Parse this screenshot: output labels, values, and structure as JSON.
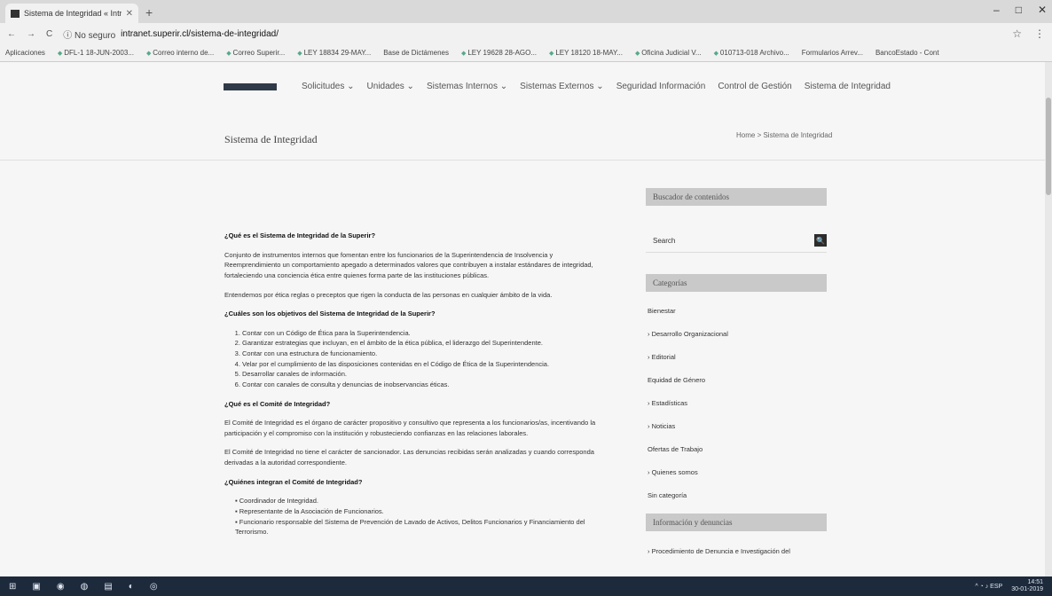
{
  "browser": {
    "tab_title": "Sistema de Integridad « Intranet",
    "tab_close": "✕",
    "new_tab": "+",
    "window_controls": [
      "–",
      "□",
      "✕"
    ],
    "nav_buttons": [
      "←",
      "→",
      "C"
    ],
    "secure_text": "ⓘ No seguro",
    "url": "intranet.superir.cl/sistema-de-integridad/",
    "star_icon": "☆",
    "menu_icon": "⋮",
    "bookmarks": [
      "Aplicaciones",
      "DFL-1 18-JUN-2003...",
      "Correo interno de...",
      "Correo Superir...",
      "LEY 18834 29-MAY...",
      "Base de Dictámenes",
      "LEY 19628 28-AGO...",
      "LEY 18120 18-MAY...",
      "Oficina Judicial V...",
      "010713-018 Archivo...",
      "Formularios Arrev...",
      "BancoEstado - Cont"
    ]
  },
  "nav": {
    "items": [
      "Solicitudes ⌄",
      "Unidades ⌄",
      "Sistemas Internos ⌄",
      "Sistemas Externos ⌄",
      "Seguridad Información",
      "Control de Gestión",
      "Sistema de Integridad"
    ]
  },
  "page": {
    "title": "Sistema de Integridad",
    "breadcrumb": "Home > Sistema de Integridad"
  },
  "content": {
    "q1": "¿Qué es el Sistema de Integridad de la Superir?",
    "p1": "Conjunto de instrumentos internos que fomentan entre los funcionarios de la Superintendencia de Insolvencia y Reemprendimiento un comportamiento apegado a determinados valores que contribuyen a instalar estándares de integridad, fortaleciendo una conciencia ética entre quienes forma parte de las instituciones públicas.",
    "p2": "Entendemos por ética reglas o preceptos que rigen la conducta de las personas en cualquier ámbito de la vida.",
    "q2": "¿Cuáles son los objetivos del Sistema de Integridad de la Superir?",
    "objectives": [
      "Contar con un Código de Ética para la Superintendencia.",
      "Garantizar estrategias que incluyan, en el ámbito de la ética pública, el liderazgo del Superintendente.",
      "Contar con una estructura de funcionamiento.",
      "Velar por el cumplimiento de las disposiciones contenidas en el Código de Ética de la Superintendencia.",
      "Desarrollar canales de información.",
      "Contar con canales de consulta y denuncias de inobservancias éticas."
    ],
    "q3": "¿Qué es el Comité de Integridad?",
    "p3": "El Comité de Integridad es el órgano de carácter propositivo y consultivo que representa a los funcionarios/as, incentivando la participación y el compromiso con la institución y robusteciendo confianzas en las relaciones laborales.",
    "p4": "El Comité de Integridad no tiene el carácter de sancionador. Las denuncias recibidas serán analizadas y cuando corresponda derivadas a la autoridad correspondiente.",
    "q4": "¿Quiénes integran el Comité de Integridad?",
    "members": [
      "Coordinador de Integridad.",
      "Representante de la Asociación de Funcionarios.",
      "Funcionario responsable del Sistema de Prevención de Lavado de Activos, Delitos Funcionarios y Financiamiento del Terrorismo."
    ]
  },
  "sidebar": {
    "search_heading": "Buscador de contenidos",
    "search_placeholder": "Search",
    "search_button": "🔍",
    "categories_heading": "Categorías",
    "categories": [
      "Bienestar",
      "› Desarrollo Organizacional",
      "› Editorial",
      "Equidad de Género",
      "› Estadísticas",
      "› Noticias",
      "Ofertas de Trabajo",
      "› Quienes somos",
      "Sin categoría"
    ],
    "info_heading": "Información y denuncias",
    "info_items": [
      "› Procedimiento de Denuncia e Investigación del"
    ]
  },
  "taskbar": {
    "icons": [
      "⊞",
      "▣",
      "◉",
      "◍",
      "▤",
      "◐",
      "◎"
    ],
    "tray": "^ ◔ ♪ ESP",
    "time": "14:51",
    "date": "30-01-2019"
  }
}
